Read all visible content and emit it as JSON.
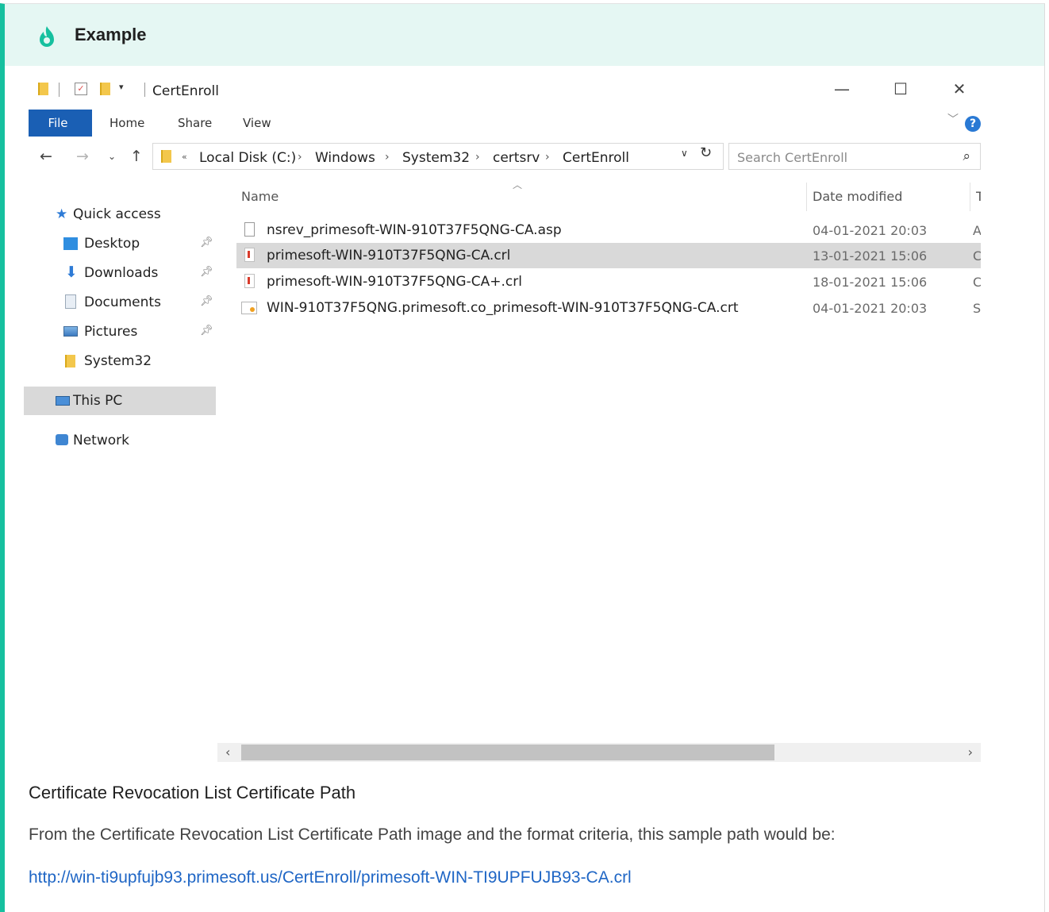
{
  "callout": {
    "title": "Example",
    "accent_color": "#16c09f",
    "icon": "flame-icon"
  },
  "window": {
    "title": "CertEnroll",
    "controls": {
      "minimize": "—",
      "maximize": "☐",
      "close": "✕"
    },
    "ribbon_tabs": [
      "File",
      "Home",
      "Share",
      "View"
    ],
    "help": "?",
    "address": {
      "overflow": "«",
      "crumbs": [
        "Local Disk (C:)",
        "Windows",
        "System32",
        "certsrv",
        "CertEnroll"
      ],
      "separator": "›"
    },
    "search": {
      "placeholder": "Search CertEnroll"
    },
    "nav": [
      {
        "label": "Quick access",
        "icon": "star-icon"
      },
      {
        "label": "Desktop",
        "icon": "desktop-icon",
        "pinned": true
      },
      {
        "label": "Downloads",
        "icon": "download-icon",
        "pinned": true
      },
      {
        "label": "Documents",
        "icon": "documents-icon",
        "pinned": true
      },
      {
        "label": "Pictures",
        "icon": "pictures-icon",
        "pinned": true
      },
      {
        "label": "System32",
        "icon": "folder-icon"
      },
      {
        "label": "This PC",
        "icon": "computer-icon",
        "selected": true
      },
      {
        "label": "Network",
        "icon": "network-icon"
      }
    ],
    "columns": {
      "name": "Name",
      "date": "Date modified",
      "type": "T"
    },
    "files": [
      {
        "name": "nsrev_primesoft-WIN-910T37F5QNG-CA.asp",
        "date": "04-01-2021 20:03",
        "type": "A",
        "icon": "file-icon"
      },
      {
        "name": "primesoft-WIN-910T37F5QNG-CA.crl",
        "date": "13-01-2021 15:06",
        "type": "C",
        "icon": "crl-file-icon",
        "selected": true
      },
      {
        "name": "primesoft-WIN-910T37F5QNG-CA+.crl",
        "date": "18-01-2021 15:06",
        "type": "C",
        "icon": "crl-file-icon"
      },
      {
        "name": "WIN-910T37F5QNG.primesoft.co_primesoft-WIN-910T37F5QNG-CA.crt",
        "date": "04-01-2021 20:03",
        "type": "S",
        "icon": "certificate-file-icon"
      }
    ]
  },
  "caption": "Certificate Revocation List Certificate Path",
  "body": "From the Certificate Revocation List Certificate Path image and the format criteria, this sample path would be:",
  "link": "http://win-ti9upfujb93.primesoft.us/CertEnroll/primesoft-WIN-TI9UPFUJB93-CA.crl"
}
